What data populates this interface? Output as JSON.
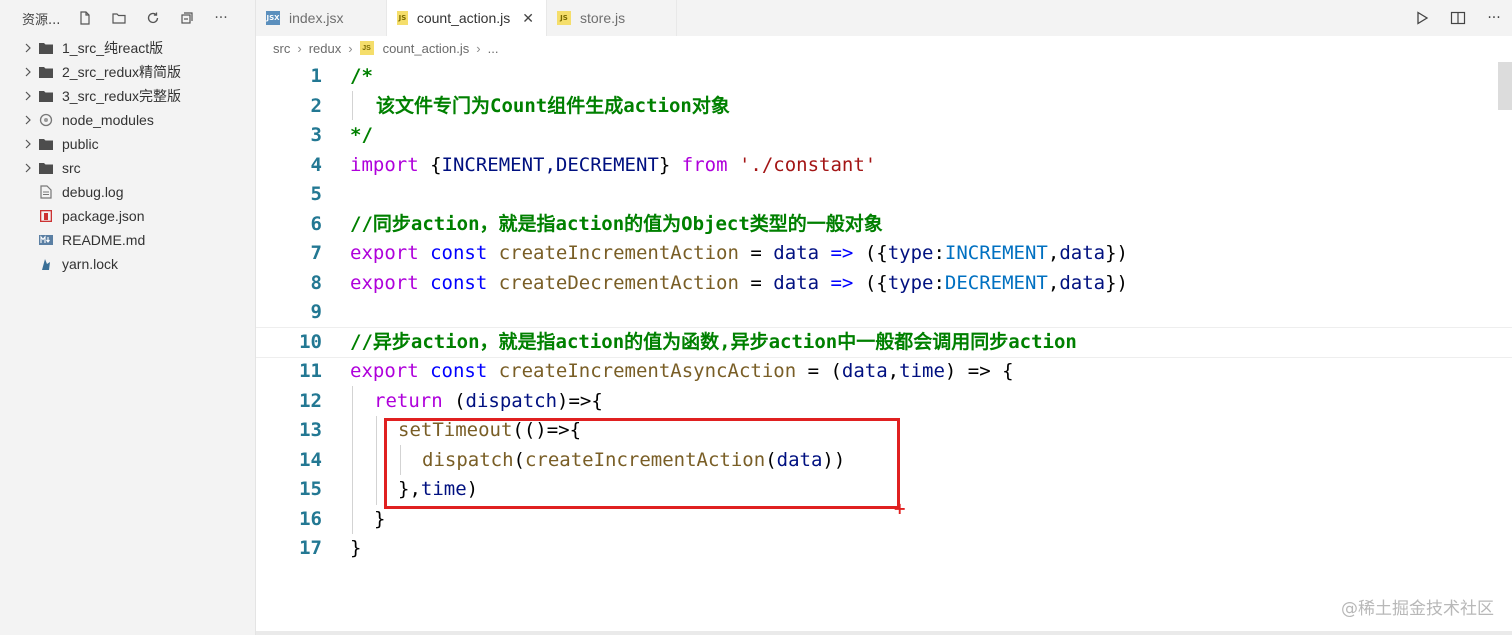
{
  "sidebar": {
    "title": "资源...",
    "actions": [
      "new-file-icon",
      "new-folder-icon",
      "refresh-icon",
      "collapse-all-icon",
      "more-icon"
    ],
    "more_label": "···",
    "items": [
      {
        "label": "1_src_纯react版",
        "type": "folder"
      },
      {
        "label": "2_src_redux精简版",
        "type": "folder"
      },
      {
        "label": "3_src_redux完整版",
        "type": "folder"
      },
      {
        "label": "node_modules",
        "type": "folder-special"
      },
      {
        "label": "public",
        "type": "folder"
      },
      {
        "label": "src",
        "type": "folder"
      },
      {
        "label": "debug.log",
        "type": "file-log"
      },
      {
        "label": "package.json",
        "type": "file-json"
      },
      {
        "label": "README.md",
        "type": "file-md"
      },
      {
        "label": "yarn.lock",
        "type": "file-yarn"
      }
    ]
  },
  "tabs": [
    {
      "label": "index.jsx",
      "icon_text": "JSX",
      "active": false
    },
    {
      "label": "count_action.js",
      "icon_text": "JS",
      "active": true
    },
    {
      "label": "store.js",
      "icon_text": "JS",
      "active": false
    }
  ],
  "tab_close": "✕",
  "breadcrumb": {
    "parts": [
      "src",
      "redux",
      "count_action.js",
      "..."
    ],
    "sep": "›",
    "file_icon_text": "JS"
  },
  "code": {
    "line_numbers": [
      "1",
      "2",
      "3",
      "4",
      "5",
      "6",
      "7",
      "8",
      "9",
      "10",
      "11",
      "12",
      "13",
      "14",
      "15",
      "16",
      "17"
    ],
    "l1": "/*",
    "l2": "该文件专门为Count组件生成action对象",
    "l3": "*/",
    "l4": {
      "import": "import",
      "brace_open": " {",
      "names": "INCREMENT,DECREMENT",
      "brace_close": "} ",
      "from": "from",
      "path": " './constant'"
    },
    "l6": "//同步action，就是指action的值为Object类型的一般对象",
    "l7": {
      "export": "export",
      "const": " const",
      "name": " createIncrementAction",
      "eq": " = ",
      "param": "data",
      "arrow": " => ",
      "open": "({",
      "type_key": "type",
      "colon": ":",
      "type_val": "INCREMENT",
      "comma": ",",
      "data": "data",
      "close": "})"
    },
    "l8": {
      "export": "export",
      "const": " const",
      "name": " createDecrementAction",
      "eq": " = ",
      "param": "data",
      "arrow": " => ",
      "open": "({",
      "type_key": "type",
      "colon": ":",
      "type_val": "DECREMENT",
      "comma": ",",
      "data": "data",
      "close": "})"
    },
    "l10": "//异步action，就是指action的值为函数,异步action中一般都会调用同步action",
    "l11": {
      "export": "export",
      "const": " const",
      "name": " createIncrementAsyncAction",
      "eq": " = (",
      "p1": "data",
      "comma": ",",
      "p2": "time",
      "rest": ") => {"
    },
    "l12": {
      "return": "return",
      "open": " (",
      "param": "dispatch",
      "rest": ")=>{"
    },
    "l13": {
      "fn": "setTimeout",
      "rest": "(()=>{"
    },
    "l14": {
      "fn": "dispatch",
      "open": "(",
      "fn2": "createIncrementAction",
      "open2": "(",
      "arg": "data",
      "close": "))"
    },
    "l15": {
      "open": "},",
      "arg": "time",
      "close": ")"
    },
    "l16": "}",
    "l17": "}"
  },
  "watermark": "@稀土掘金技术社区",
  "colors": {
    "highlight_box": "#e02020",
    "line_number": "#237893",
    "comment": "#008000",
    "keyword": "#af00db"
  }
}
